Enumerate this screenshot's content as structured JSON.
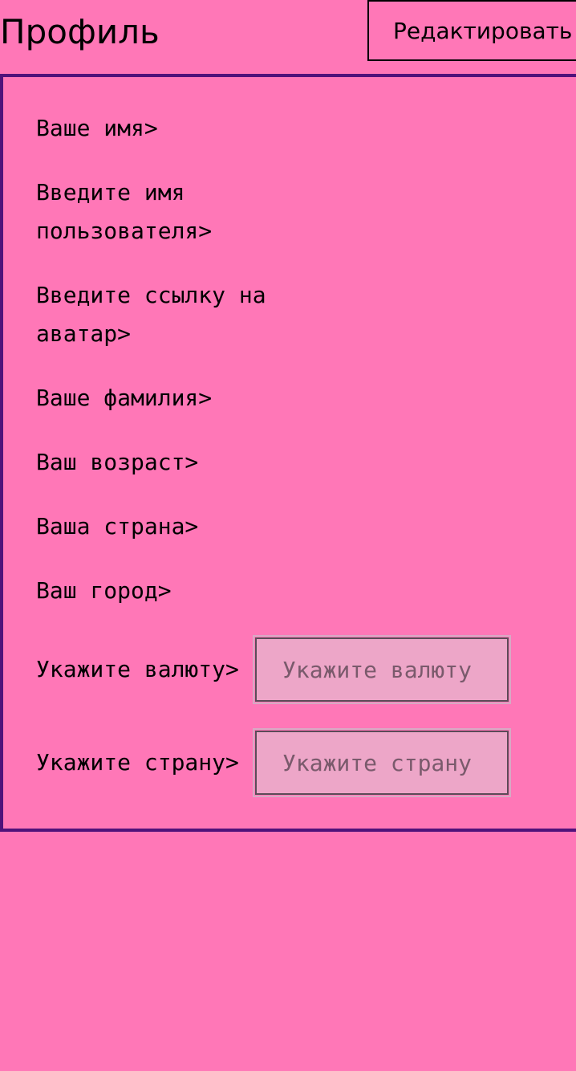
{
  "header": {
    "title": "Профиль",
    "edit_label": "Редактировать"
  },
  "form": {
    "fields": [
      {
        "label": "Ваше имя>"
      },
      {
        "label": "Введите имя\nпользователя>"
      },
      {
        "label": "Введите ссылку на\nаватар>"
      },
      {
        "label": "Ваше фамилия>"
      },
      {
        "label": "Ваш возраст>"
      },
      {
        "label": "Ваша страна>"
      },
      {
        "label": "Ваш город>"
      },
      {
        "label": "Укажите валюту>",
        "placeholder": "Укажите валюту"
      },
      {
        "label": "Укажите страну>",
        "placeholder": "Укажите страну"
      }
    ]
  },
  "colors": {
    "background": "#ff77b7",
    "panel_border": "#50127a",
    "input_background": "#eda6c8",
    "text": "#000000"
  }
}
